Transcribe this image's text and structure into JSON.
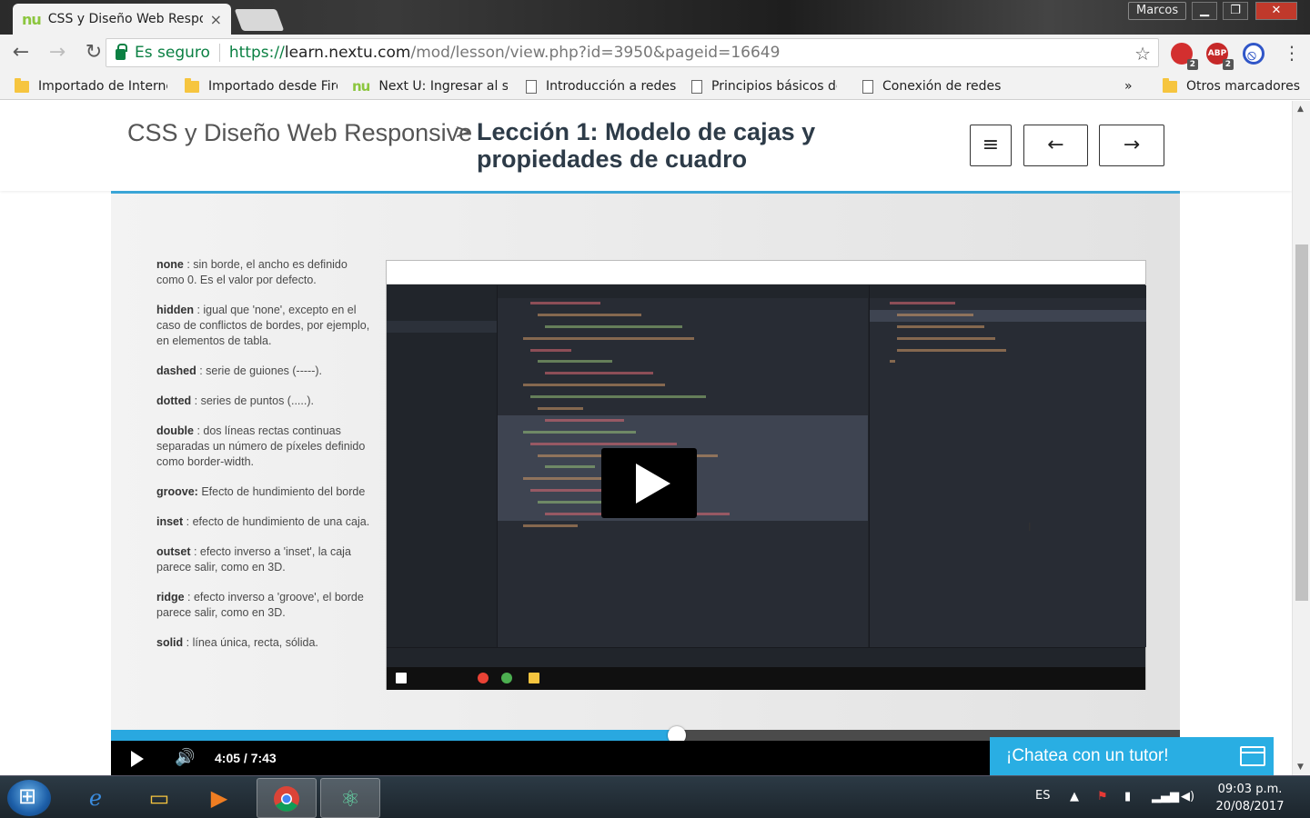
{
  "browser": {
    "tab_title": "CSS y Diseño Web Respo",
    "tab_logo": "nu",
    "profile_name": "Marcos",
    "security_label": "Es seguro",
    "url_scheme": "https://",
    "url_host": "learn.nextu.com",
    "url_path": "/mod/lesson/view.php?id=3950&pageid=16649",
    "extensions": [
      {
        "name": "extension-red-icon",
        "badge": "2"
      },
      {
        "name": "adblock-icon",
        "label": "ABP",
        "badge": "2"
      },
      {
        "name": "block-icon"
      }
    ]
  },
  "bookmarks": {
    "items": [
      {
        "icon": "folder",
        "label": "Importado de Interne"
      },
      {
        "icon": "folder",
        "label": "Importado desde Fire"
      },
      {
        "icon": "nu",
        "label": "Next U: Ingresar al sit"
      },
      {
        "icon": "page",
        "label": "Introducción a redes"
      },
      {
        "icon": "page",
        "label": "Principios básicos de"
      },
      {
        "icon": "page",
        "label": "Conexión de redes"
      }
    ],
    "overflow": "»",
    "other": "Otros marcadores"
  },
  "lesson": {
    "course": "CSS y Diseño Web Responsive",
    "separator": ">",
    "title": "Lección 1: Modelo de cajas y propiedades de cuadro",
    "menu_symbol": "≡",
    "prev_symbol": "←",
    "next_symbol": "→"
  },
  "slide": {
    "notes": [
      {
        "term": "none",
        "text": " : sin borde, el ancho es definido como 0. Es el valor por defecto."
      },
      {
        "term": "hidden",
        "text": " : igual que 'none', excepto en el caso de conflictos de bordes, por ejemplo, en elementos de tabla."
      },
      {
        "term": "dashed",
        "text": " : serie de guiones (-----)."
      },
      {
        "term": "dotted",
        "text": " : series de puntos (.....)."
      },
      {
        "term": "double",
        "text": " : dos líneas rectas continuas separadas un número de píxeles definido como border-width."
      },
      {
        "term": "groove:",
        "text": " Efecto de hundimiento del borde"
      },
      {
        "term": "inset",
        "text": " : efecto de hundimiento de una caja."
      },
      {
        "term": "outset",
        "text": " : efecto inverso a 'inset', la caja parece salir, como en 3D."
      },
      {
        "term": "ridge",
        "text": " : efecto inverso a 'groove', el borde parece salir, como en 3D."
      },
      {
        "term": "solid",
        "text": " : línea única, recta, sólida."
      }
    ]
  },
  "video": {
    "current_time": "4:05",
    "duration": "/ 7:43",
    "progress_fraction": 0.529
  },
  "chat": {
    "label": "¡Chatea con un tutor!"
  },
  "taskbar": {
    "apps": [
      "ie-icon",
      "file-explorer-icon",
      "media-player-icon",
      "chrome-icon",
      "atom-icon"
    ],
    "language": "ES",
    "time": "09:03 p.m.",
    "date": "20/08/2017"
  },
  "colors": {
    "accent": "#29a8e0",
    "secure_green": "#0b8043",
    "nextu_green": "#8cc63f"
  }
}
